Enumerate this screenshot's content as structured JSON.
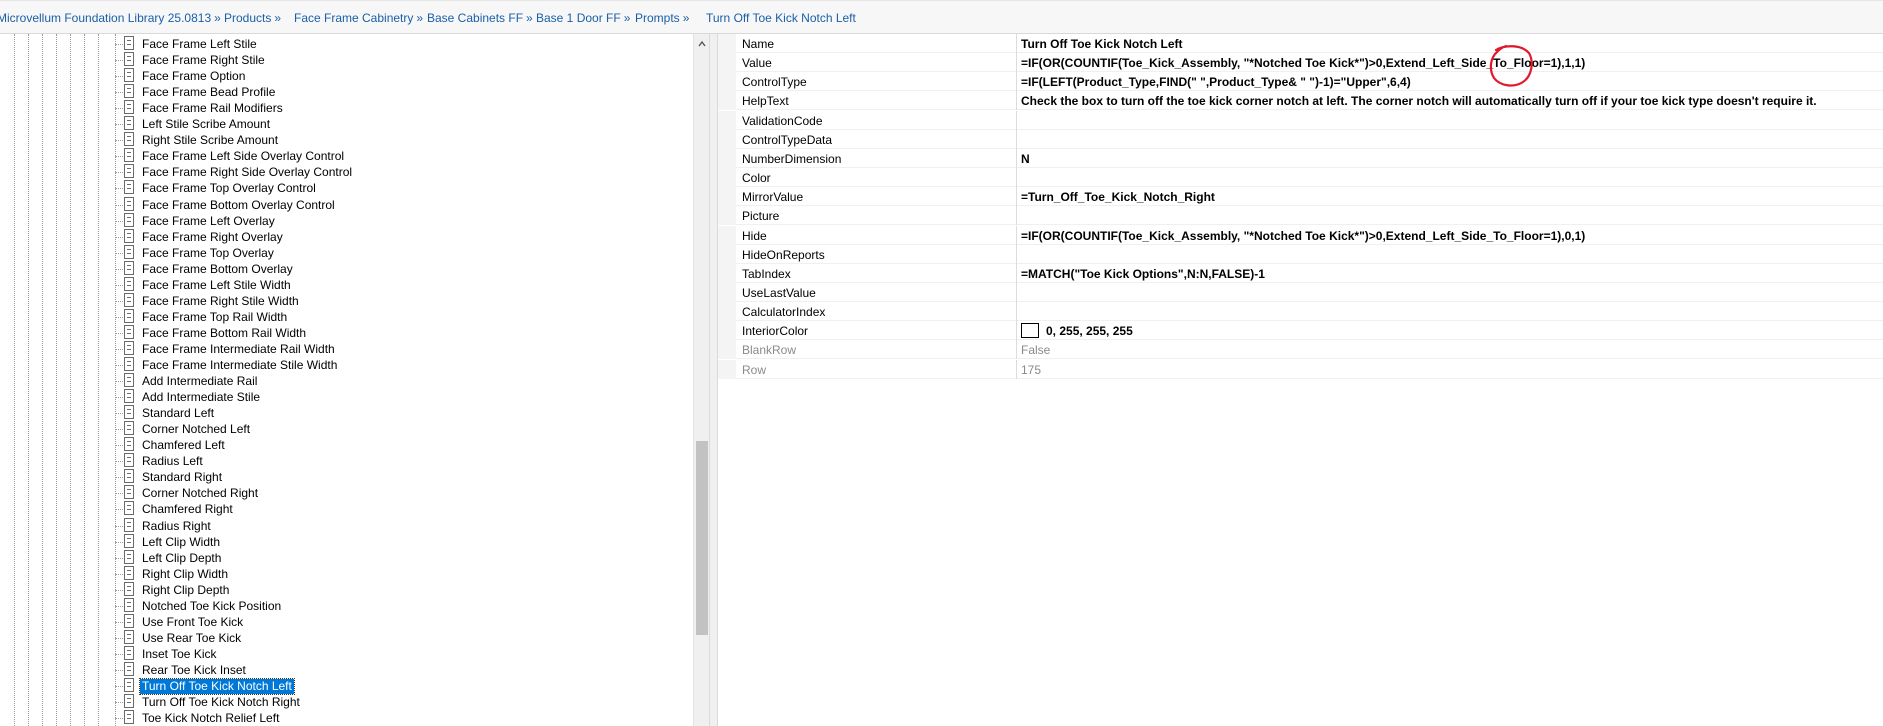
{
  "breadcrumb": [
    {
      "label": "Microvellum Foundation Library 25.0813",
      "sep": "»"
    },
    {
      "label": "Products",
      "sep": "»"
    },
    {
      "label": "Face Frame Cabinetry",
      "sep": "»"
    },
    {
      "label": "Base Cabinets FF",
      "sep": "»"
    },
    {
      "label": "Base 1 Door FF",
      "sep": "»"
    },
    {
      "label": "Prompts",
      "sep": "»"
    },
    {
      "label": "Turn Off Toe Kick Notch Left",
      "sep": ""
    }
  ],
  "tree": {
    "selected": "Turn Off Toe Kick Notch Left",
    "items": [
      "Face Frame Left Stile",
      "Face Frame Right Stile",
      "Face Frame Option",
      "Face Frame Bead Profile",
      "Face Frame Rail Modifiers",
      "Left Stile Scribe Amount",
      "Right Stile Scribe Amount",
      "Face Frame Left Side Overlay Control",
      "Face Frame Right Side Overlay Control",
      "Face Frame Top Overlay Control",
      "Face Frame Bottom Overlay Control",
      "Face Frame Left Overlay",
      "Face Frame Right Overlay",
      "Face Frame Top Overlay",
      "Face Frame Bottom Overlay",
      "Face Frame Left Stile Width",
      "Face Frame Right Stile Width",
      "Face Frame Top Rail Width",
      "Face Frame Bottom Rail Width",
      "Face Frame Intermediate Rail Width",
      "Face Frame Intermediate Stile Width",
      "Add Intermediate Rail",
      "Add Intermediate Stile",
      "Standard Left",
      "Corner Notched Left",
      "Chamfered Left",
      "Radius Left",
      "Standard Right",
      "Corner Notched Right",
      "Chamfered Right",
      "Radius Right",
      "Left Clip Width",
      "Left Clip Depth",
      "Right Clip Width",
      "Right Clip Depth",
      "Notched Toe Kick Position",
      "Use Front Toe Kick",
      "Use Rear Toe Kick",
      "Inset Toe Kick",
      "Rear Toe Kick Inset",
      "Turn Off Toe Kick Notch Left",
      "Turn Off Toe Kick Notch Right",
      "Toe Kick Notch Relief Left"
    ]
  },
  "properties": [
    {
      "name": "Name",
      "value": "Turn Off Toe Kick Notch Left"
    },
    {
      "name": "Value",
      "value": "=IF(OR(COUNTIF(Toe_Kick_Assembly, \"*Notched Toe Kick*\")>0,Extend_Left_Side_To_Floor=1),1,1)"
    },
    {
      "name": "ControlType",
      "value": "=IF(LEFT(Product_Type,FIND(\" \",Product_Type& \" \")-1)=\"Upper\",6,4)"
    },
    {
      "name": "HelpText",
      "value": "Check the box to turn off the toe kick corner notch at left. The corner notch will automatically turn off if your toe kick type doesn't require it."
    },
    {
      "name": "ValidationCode",
      "value": ""
    },
    {
      "name": "ControlTypeData",
      "value": ""
    },
    {
      "name": "NumberDimension",
      "value": "N"
    },
    {
      "name": "Color",
      "value": ""
    },
    {
      "name": "MirrorValue",
      "value": "=Turn_Off_Toe_Kick_Notch_Right"
    },
    {
      "name": "Picture",
      "value": ""
    },
    {
      "name": "Hide",
      "value": "=IF(OR(COUNTIF(Toe_Kick_Assembly, \"*Notched Toe Kick*\")>0,Extend_Left_Side_To_Floor=1),0,1)"
    },
    {
      "name": "HideOnReports",
      "value": ""
    },
    {
      "name": "TabIndex",
      "value": "=MATCH(\"Toe Kick Options\",N:N,FALSE)-1"
    },
    {
      "name": "UseLastValue",
      "value": ""
    },
    {
      "name": "CalculatorIndex",
      "value": ""
    },
    {
      "name": "InteriorColor",
      "value": "0, 255, 255, 255",
      "swatch": "#ffffff"
    },
    {
      "name": "BlankRow",
      "value": "False",
      "readonly": true
    },
    {
      "name": "Row",
      "value": "175",
      "readonly": true
    }
  ],
  "colors": {
    "link": "#1a5fa8",
    "selection": "#0078d7",
    "annotation": "#e0192b"
  }
}
